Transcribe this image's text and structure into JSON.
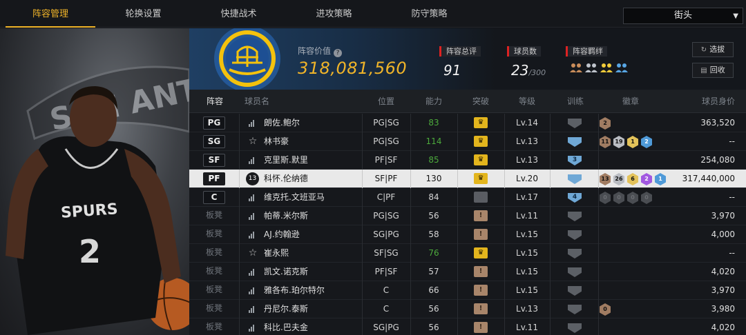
{
  "nav": {
    "tabs": [
      "阵容管理",
      "轮换设置",
      "快捷战术",
      "进攻策略",
      "防守策略"
    ],
    "dropdown": "街头"
  },
  "summary": {
    "value_label": "阵容价值",
    "value": "318,081,560",
    "rating_label": "阵容总评",
    "rating": "91",
    "players_label": "球员数",
    "players": "23",
    "players_max": "/300",
    "chem_label": "阵容羁绊",
    "btn_filter": "选拔",
    "btn_recycle": "回收"
  },
  "headers": [
    "阵容",
    "球员名",
    "位置",
    "能力",
    "突破",
    "等级",
    "训练",
    "徽章",
    "球员身价"
  ],
  "rows": [
    {
      "slot": "PG",
      "name": "朗佐.鲍尔",
      "pos": "PG|SG",
      "ovr": "83",
      "ovr_green": true,
      "crown": "gold",
      "lv": "Lv.14",
      "train": "",
      "train_color": "gray",
      "badges": [
        {
          "t": "2",
          "c": "bronze"
        }
      ],
      "price": "363,520"
    },
    {
      "slot": "SG",
      "name": "林书豪",
      "pos": "PG|SG",
      "ovr": "114",
      "ovr_green": true,
      "crown": "gold",
      "lv": "Lv.13",
      "train": "",
      "train_color": "blue",
      "badges": [
        {
          "t": "11",
          "c": "bronze"
        },
        {
          "t": "19",
          "c": "silver"
        },
        {
          "t": "1",
          "c": "gold"
        },
        {
          "t": "2",
          "c": "blue"
        }
      ],
      "price": "--"
    },
    {
      "slot": "SF",
      "name": "克里斯.默里",
      "pos": "PF|SF",
      "ovr": "85",
      "ovr_green": true,
      "crown": "gold",
      "lv": "Lv.13",
      "train": "3",
      "train_color": "blue",
      "badges": [],
      "price": "254,080"
    },
    {
      "slot": "PF",
      "name": "科怀.伦纳德",
      "pos": "SF|PF",
      "ovr": "130",
      "ovr_green": false,
      "crown": "gold",
      "lv": "Lv.20",
      "train": "",
      "train_color": "blue",
      "badges": [
        {
          "t": "13",
          "c": "bronze"
        },
        {
          "t": "26",
          "c": "silver"
        },
        {
          "t": "6",
          "c": "gold"
        },
        {
          "t": "2",
          "c": "purple"
        },
        {
          "t": "1",
          "c": "blue"
        }
      ],
      "price": "317,440,000",
      "selected": true
    },
    {
      "slot": "C",
      "name": "维克托.文班亚马",
      "pos": "C|PF",
      "ovr": "84",
      "ovr_green": false,
      "crown": "gray",
      "lv": "Lv.17",
      "train": "4",
      "train_color": "blue",
      "badges": [
        {
          "t": "0",
          "c": "empty"
        },
        {
          "t": "0",
          "c": "empty"
        },
        {
          "t": "0",
          "c": "empty"
        },
        {
          "t": "0",
          "c": "empty"
        }
      ],
      "price": "--"
    },
    {
      "slot": "板凳",
      "name": "帕蒂.米尔斯",
      "pos": "PG|SG",
      "ovr": "56",
      "ovr_green": false,
      "crown": "brown",
      "lv": "Lv.11",
      "train": "",
      "train_color": "gray",
      "badges": [],
      "price": "3,970"
    },
    {
      "slot": "板凳",
      "name": "AJ.约翰逊",
      "pos": "SG|PG",
      "ovr": "58",
      "ovr_green": false,
      "crown": "brown",
      "lv": "Lv.15",
      "train": "",
      "train_color": "gray",
      "badges": [],
      "price": "4,000"
    },
    {
      "slot": "板凳",
      "name": "崔永熙",
      "pos": "SF|SG",
      "ovr": "76",
      "ovr_green": true,
      "crown": "gold",
      "lv": "Lv.15",
      "train": "",
      "train_color": "gray",
      "badges": [],
      "price": "--"
    },
    {
      "slot": "板凳",
      "name": "凯文.诺克斯",
      "pos": "PF|SF",
      "ovr": "57",
      "ovr_green": false,
      "crown": "brown",
      "lv": "Lv.15",
      "train": "",
      "train_color": "gray",
      "badges": [],
      "price": "4,020"
    },
    {
      "slot": "板凳",
      "name": "雅各布.珀尔特尔",
      "pos": "C",
      "ovr": "66",
      "ovr_green": false,
      "crown": "brown",
      "lv": "Lv.15",
      "train": "",
      "train_color": "gray",
      "badges": [],
      "price": "3,970"
    },
    {
      "slot": "板凳",
      "name": "丹尼尔.泰斯",
      "pos": "C",
      "ovr": "56",
      "ovr_green": false,
      "crown": "brown",
      "lv": "Lv.13",
      "train": "",
      "train_color": "gray",
      "badges": [
        {
          "t": "0",
          "c": "bronze"
        }
      ],
      "price": "3,980"
    },
    {
      "slot": "板凳",
      "name": "科比.巴夫金",
      "pos": "SG|PG",
      "ovr": "56",
      "ovr_green": false,
      "crown": "brown",
      "lv": "Lv.11",
      "train": "",
      "train_color": "gray",
      "badges": [],
      "price": "4,020"
    }
  ],
  "art": {
    "jersey_team": "SPURS",
    "jersey_number": "2",
    "banner_text": "SAN ANTONIO SPURS",
    "selected_player_number": "13"
  }
}
